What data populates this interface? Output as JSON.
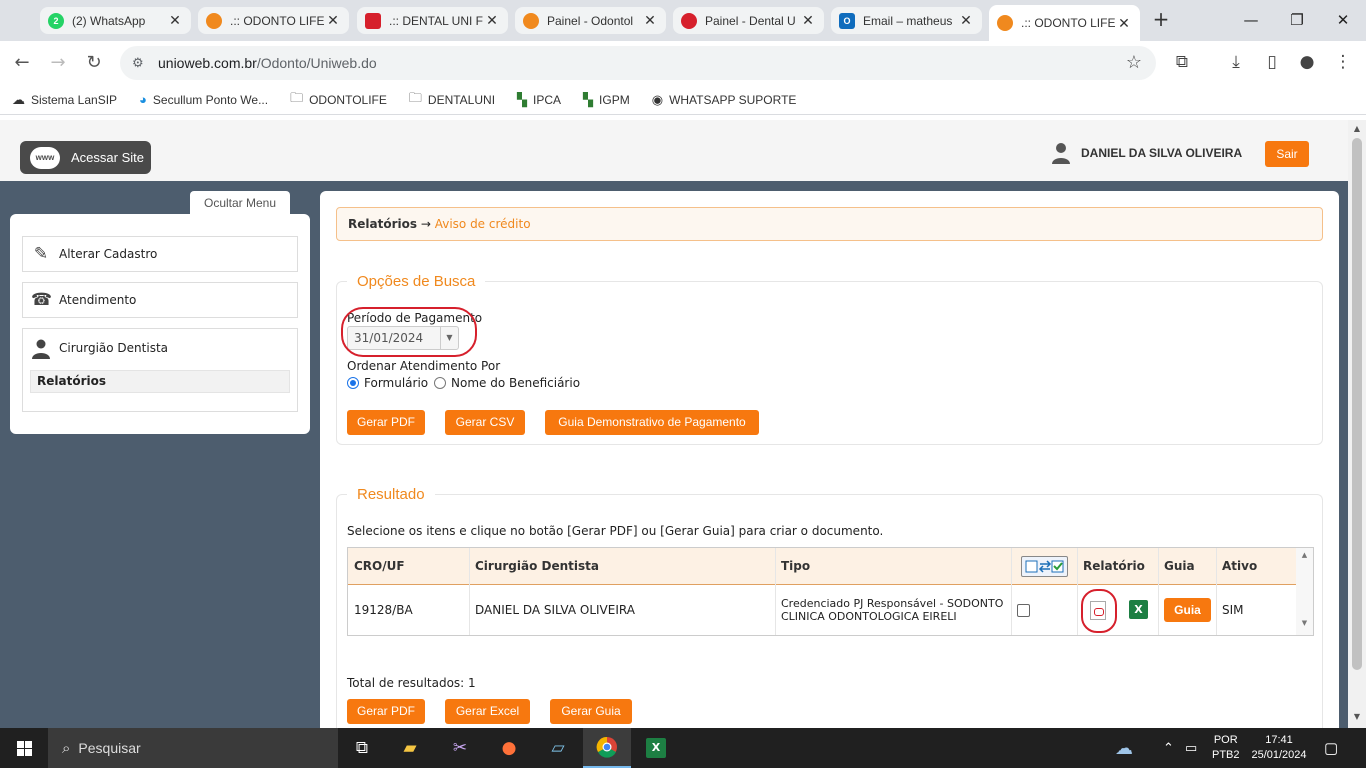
{
  "browser": {
    "tabs": [
      {
        "label": "(2) WhatsApp",
        "favicon_color": "#25d366",
        "favicon_text": "2"
      },
      {
        "label": ".:: ODONTO LIFE",
        "favicon_color": "#f0891e",
        "favicon_text": ""
      },
      {
        "label": ".:: DENTAL UNI F",
        "favicon_color": "#d6202c",
        "favicon_text": ""
      },
      {
        "label": "Painel - Odontol",
        "favicon_color": "#f0891e",
        "favicon_text": ""
      },
      {
        "label": "Painel - Dental U",
        "favicon_color": "#d6202c",
        "favicon_text": ""
      },
      {
        "label": "Email – matheus",
        "favicon_color": "#0f6cbd",
        "favicon_text": "O"
      },
      {
        "label": ".:: ODONTO LIFE",
        "favicon_color": "#f0891e",
        "favicon_text": ""
      }
    ],
    "url_host": "unioweb.com.br",
    "url_path": "/Odonto/Uniweb.do",
    "bookmarks": [
      {
        "label": "Sistema LanSIP",
        "icon": "cloud-icon"
      },
      {
        "label": "Secullum Ponto We...",
        "icon": "globe-icon"
      },
      {
        "label": "ODONTOLIFE",
        "icon": "folder-icon"
      },
      {
        "label": "DENTALUNI",
        "icon": "folder-icon"
      },
      {
        "label": "IPCA",
        "icon": "bookmark-icon"
      },
      {
        "label": "IGPM",
        "icon": "bookmark-icon"
      },
      {
        "label": "WHATSAPP SUPORTE",
        "icon": "globe-icon"
      }
    ]
  },
  "header": {
    "site_button": "Acessar Site",
    "www_badge": "www",
    "user_name": "DANIEL DA SILVA OLIVEIRA",
    "logout": "Sair"
  },
  "sidebar": {
    "toggle": "Ocultar Menu",
    "items": [
      {
        "label": "Alterar Cadastro"
      },
      {
        "label": "Atendimento"
      },
      {
        "label": "Cirurgião Dentista"
      }
    ],
    "subitem": "Relatórios"
  },
  "breadcrumb": {
    "section": "Relatórios",
    "arrow": "→",
    "page": "Aviso de crédito"
  },
  "search": {
    "legend": "Opções de Busca",
    "period_label": "Período de Pagamento",
    "period_value": "31/01/2024",
    "order_label": "Ordenar Atendimento Por",
    "order_options": [
      "Formulário",
      "Nome do Beneficiário"
    ],
    "buttons": [
      "Gerar PDF",
      "Gerar CSV",
      "Guia Demonstrativo de Pagamento"
    ]
  },
  "result": {
    "legend": "Resultado",
    "hint": "Selecione os itens e clique no botão [Gerar PDF] ou [Gerar Guia] para criar o documento.",
    "columns": [
      "CRO/UF",
      "Cirurgião Dentista",
      "Tipo",
      "Relatório",
      "Guia",
      "Ativo"
    ],
    "rows": [
      {
        "cro": "19128/BA",
        "dentist": "DANIEL DA SILVA OLIVEIRA",
        "tipo": "Credenciado PJ Responsável - SODONTO CLINICA ODONTOLOGICA EIRELI",
        "guia": "Guia",
        "ativo": "SIM"
      }
    ],
    "total": "Total de resultados: 1",
    "buttons": [
      "Gerar PDF",
      "Gerar Excel",
      "Gerar Guia"
    ]
  },
  "taskbar": {
    "search_placeholder": "Pesquisar",
    "lang": "POR",
    "layout": "PTB2",
    "time": "17:41",
    "date": "25/01/2024"
  },
  "colors": {
    "accent": "#f7780f",
    "legend": "#f0891e",
    "highlight_circle": "#d6202c",
    "sidebar_bg": "#4d5d6e"
  }
}
